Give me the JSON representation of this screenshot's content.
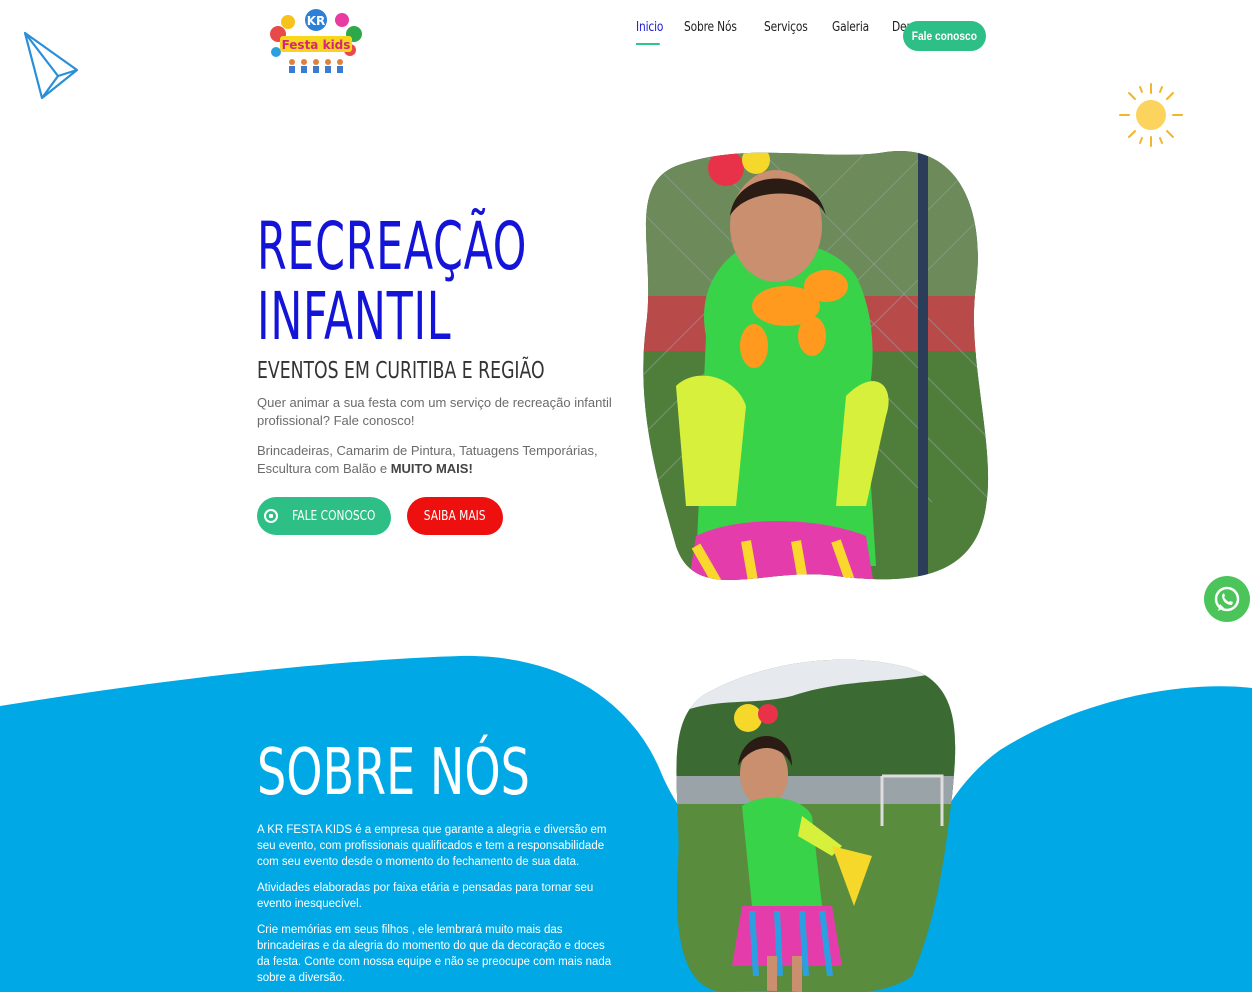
{
  "logo": {
    "top": "KR",
    "bottom": "Festa kids"
  },
  "nav": {
    "items": [
      "Inicio",
      "Sobre Nós",
      "Serviços",
      "Galeria",
      "Depoimentos"
    ],
    "cta": "Fale conosco"
  },
  "hero": {
    "title_line1": "RECREAÇÃO",
    "title_line2": "INFANTIL",
    "subtitle": "EVENTOS EM CURITIBA E REGIÃO",
    "p1": "Quer animar a sua festa com um serviço de recreação infantil profissional? Fale conosco!",
    "p2_text": "Brincadeiras, Camarim de Pintura, Tatuagens Temporárias, Escultura com Balão e",
    "p2_bold": "MUITO MAIS!",
    "btn_fale": "FALE CONOSCO",
    "btn_saiba": "SAIBA MAIS"
  },
  "about": {
    "title": "SOBRE NÓS",
    "p1": "A KR FESTA KIDS é a empresa que garante a alegria e diversão em seu evento, com profissionais qualificados e tem a responsabilidade com seu evento desde o momento do fechamento de sua data.",
    "p2": "Atividades elaboradas por faixa etária e pensadas para tornar seu evento inesquecível.",
    "p3": "Crie memórias em seus filhos , ele lembrará muito mais das brincadeiras e da alegria do momento do que da decoração e doces da festa. Conte com nossa equipe e não se preocupe com mais nada sobre a diversão."
  },
  "colors": {
    "primary_blue": "#1414d8",
    "green": "#2dbf86",
    "red": "#ee0f0f",
    "section_blue": "#00a9e6",
    "whatsapp": "#4bc45a"
  },
  "icons": [
    "paper-plane-icon",
    "sun-icon",
    "whatsapp-icon"
  ]
}
